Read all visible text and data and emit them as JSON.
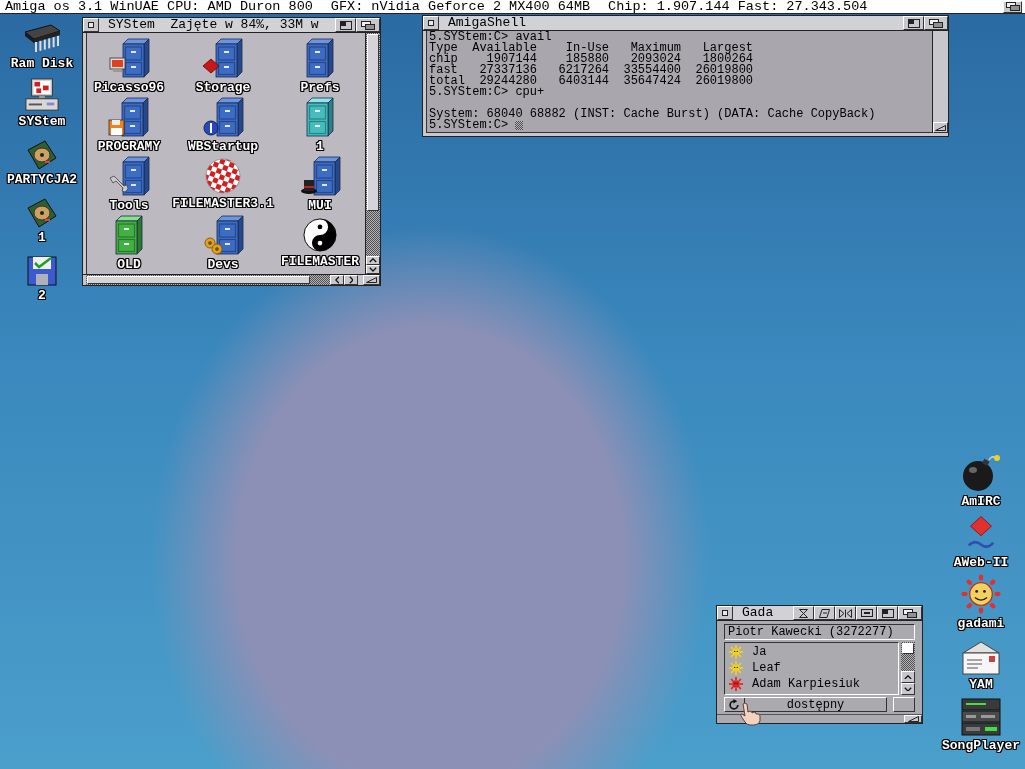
{
  "screen_title": {
    "parts": [
      "Amiga os 3.1 WinUAE CPU: AMD Duron 800",
      "GFX: nVidia Geforce 2 MX400 64MB",
      "Chip: 1.907.144 Fast: 27.343.504"
    ]
  },
  "desktop_left": [
    {
      "label": "Ram Disk"
    },
    {
      "label": "SYStem"
    },
    {
      "label": "PARTYCJA2"
    },
    {
      "label": "1"
    },
    {
      "label": "2"
    }
  ],
  "system_window": {
    "title": "SYStem  Zajęte w 84%, 33M w",
    "icons": [
      {
        "label": "Picasso96"
      },
      {
        "label": "Storage"
      },
      {
        "label": "Prefs"
      },
      {
        "label": "PROGRAMY"
      },
      {
        "label": "WBStartup"
      },
      {
        "label": "1"
      },
      {
        "label": "Tools"
      },
      {
        "label": "FILEMASTER3.1"
      },
      {
        "label": "MUI"
      },
      {
        "label": "OLD"
      },
      {
        "label": "Devs"
      },
      {
        "label": "FILEMASTER"
      }
    ]
  },
  "shell_window": {
    "title": "AmigaShell",
    "lines": [
      {
        "kind": "line",
        "text": "5.SYStem:C> avail"
      },
      {
        "kind": "line",
        "text": "Type  Available    In-Use   Maximum   Largest"
      },
      {
        "kind": "line",
        "text": "chip    1907144    185880   2093024   1800264"
      },
      {
        "kind": "line",
        "text": "fast   27337136   6217264  33554400  26019800"
      },
      {
        "kind": "line",
        "text": "total  29244280   6403144  35647424  26019800"
      },
      {
        "kind": "line",
        "text": "5.SYStem:C> cpu+"
      },
      {
        "kind": "blank"
      },
      {
        "kind": "line",
        "text": "System: 68040 68882 (INST: Cache Burst) (DATA: Cache CopyBack)"
      },
      {
        "kind": "prompt",
        "text": "5.SYStem:C>"
      }
    ]
  },
  "desktop_right": [
    {
      "label": "AmIRC"
    },
    {
      "label": "AWeb-II"
    },
    {
      "label": "gadami"
    },
    {
      "label": "YAM"
    },
    {
      "label": "SongPlayer"
    }
  ],
  "gada_window": {
    "title": "Gada",
    "user": "Piotr Kawecki (3272277)",
    "contacts": [
      {
        "name": "Ja",
        "color": "#f0d020"
      },
      {
        "name": "Leaf",
        "color": "#f0d020"
      },
      {
        "name": "Adam Karpiesiuk",
        "color": "#e02020"
      }
    ],
    "status": "dostępny"
  }
}
